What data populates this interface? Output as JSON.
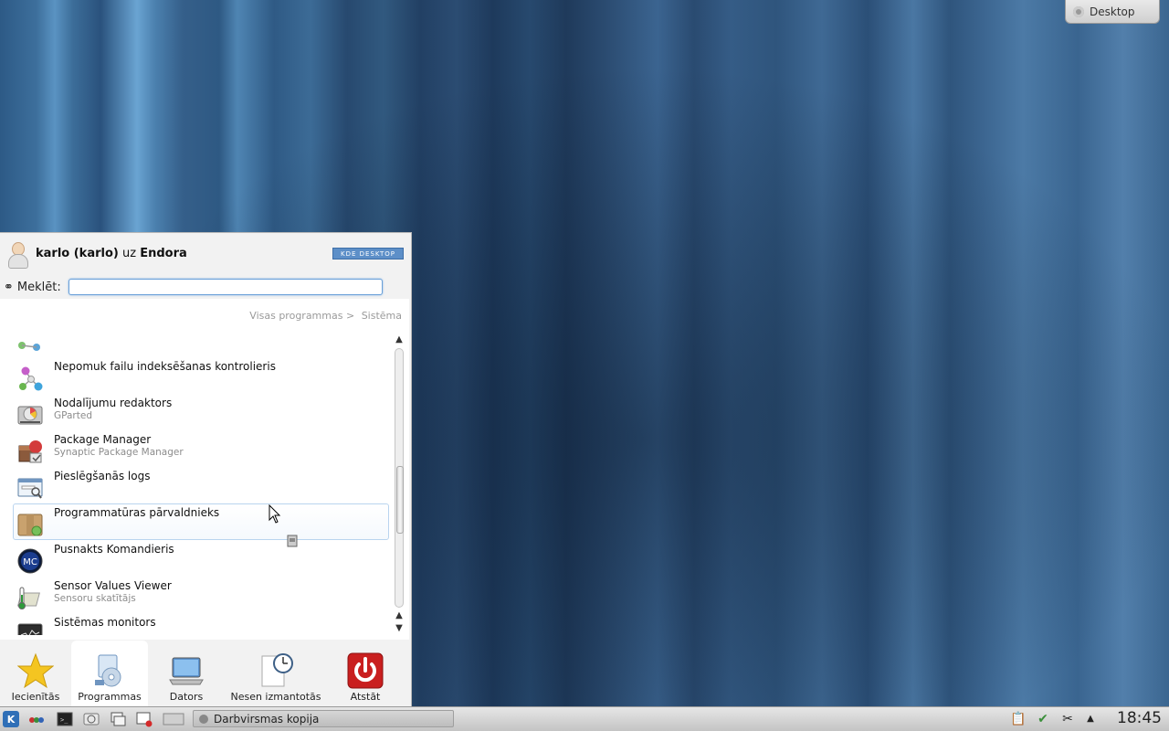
{
  "desktop_toolbox": {
    "label": "Desktop"
  },
  "kickoff": {
    "user": {
      "name": "karlo (karlo)",
      "connector": "uz",
      "host": "Endora"
    },
    "badge": "KDE DESKTOP",
    "search": {
      "label": "Meklēt:",
      "value": "",
      "placeholder": ""
    },
    "breadcrumb": {
      "root": "Visas programmas >",
      "current": "Sistēma"
    },
    "items": [
      {
        "title": "",
        "subtitle": "",
        "icon": "nepomuk-icon"
      },
      {
        "title": "Nepomuk failu indeksēšanas kontrolieris",
        "subtitle": "",
        "icon": "nepomuk-icon"
      },
      {
        "title": "Nodalījumu redaktors",
        "subtitle": "GParted",
        "icon": "disk-icon"
      },
      {
        "title": "Package Manager",
        "subtitle": "Synaptic Package Manager",
        "icon": "package-icon"
      },
      {
        "title": "Pieslēgšanās logs",
        "subtitle": "",
        "icon": "login-window-icon"
      },
      {
        "title": "Programmatūras pārvaldnieks",
        "subtitle": "",
        "icon": "software-box-icon"
      },
      {
        "title": "Pusnakts Komandieris",
        "subtitle": "",
        "icon": "midnight-commander-icon"
      },
      {
        "title": "Sensor Values Viewer",
        "subtitle": "Sensoru skatītājs",
        "icon": "thermometer-icon"
      },
      {
        "title": "Sistēmas monitors",
        "subtitle": "",
        "icon": "system-monitor-icon"
      }
    ],
    "tabs": [
      {
        "label": "Iecienītās",
        "icon": "star-icon"
      },
      {
        "label": "Programmas",
        "icon": "applications-icon"
      },
      {
        "label": "Dators",
        "icon": "computer-icon"
      },
      {
        "label": "Nesen izmantotās",
        "icon": "recent-icon"
      },
      {
        "label": "Atstāt",
        "icon": "power-icon"
      }
    ]
  },
  "taskbar": {
    "task": "Darbvirsmas kopija",
    "clock": "18:45"
  }
}
